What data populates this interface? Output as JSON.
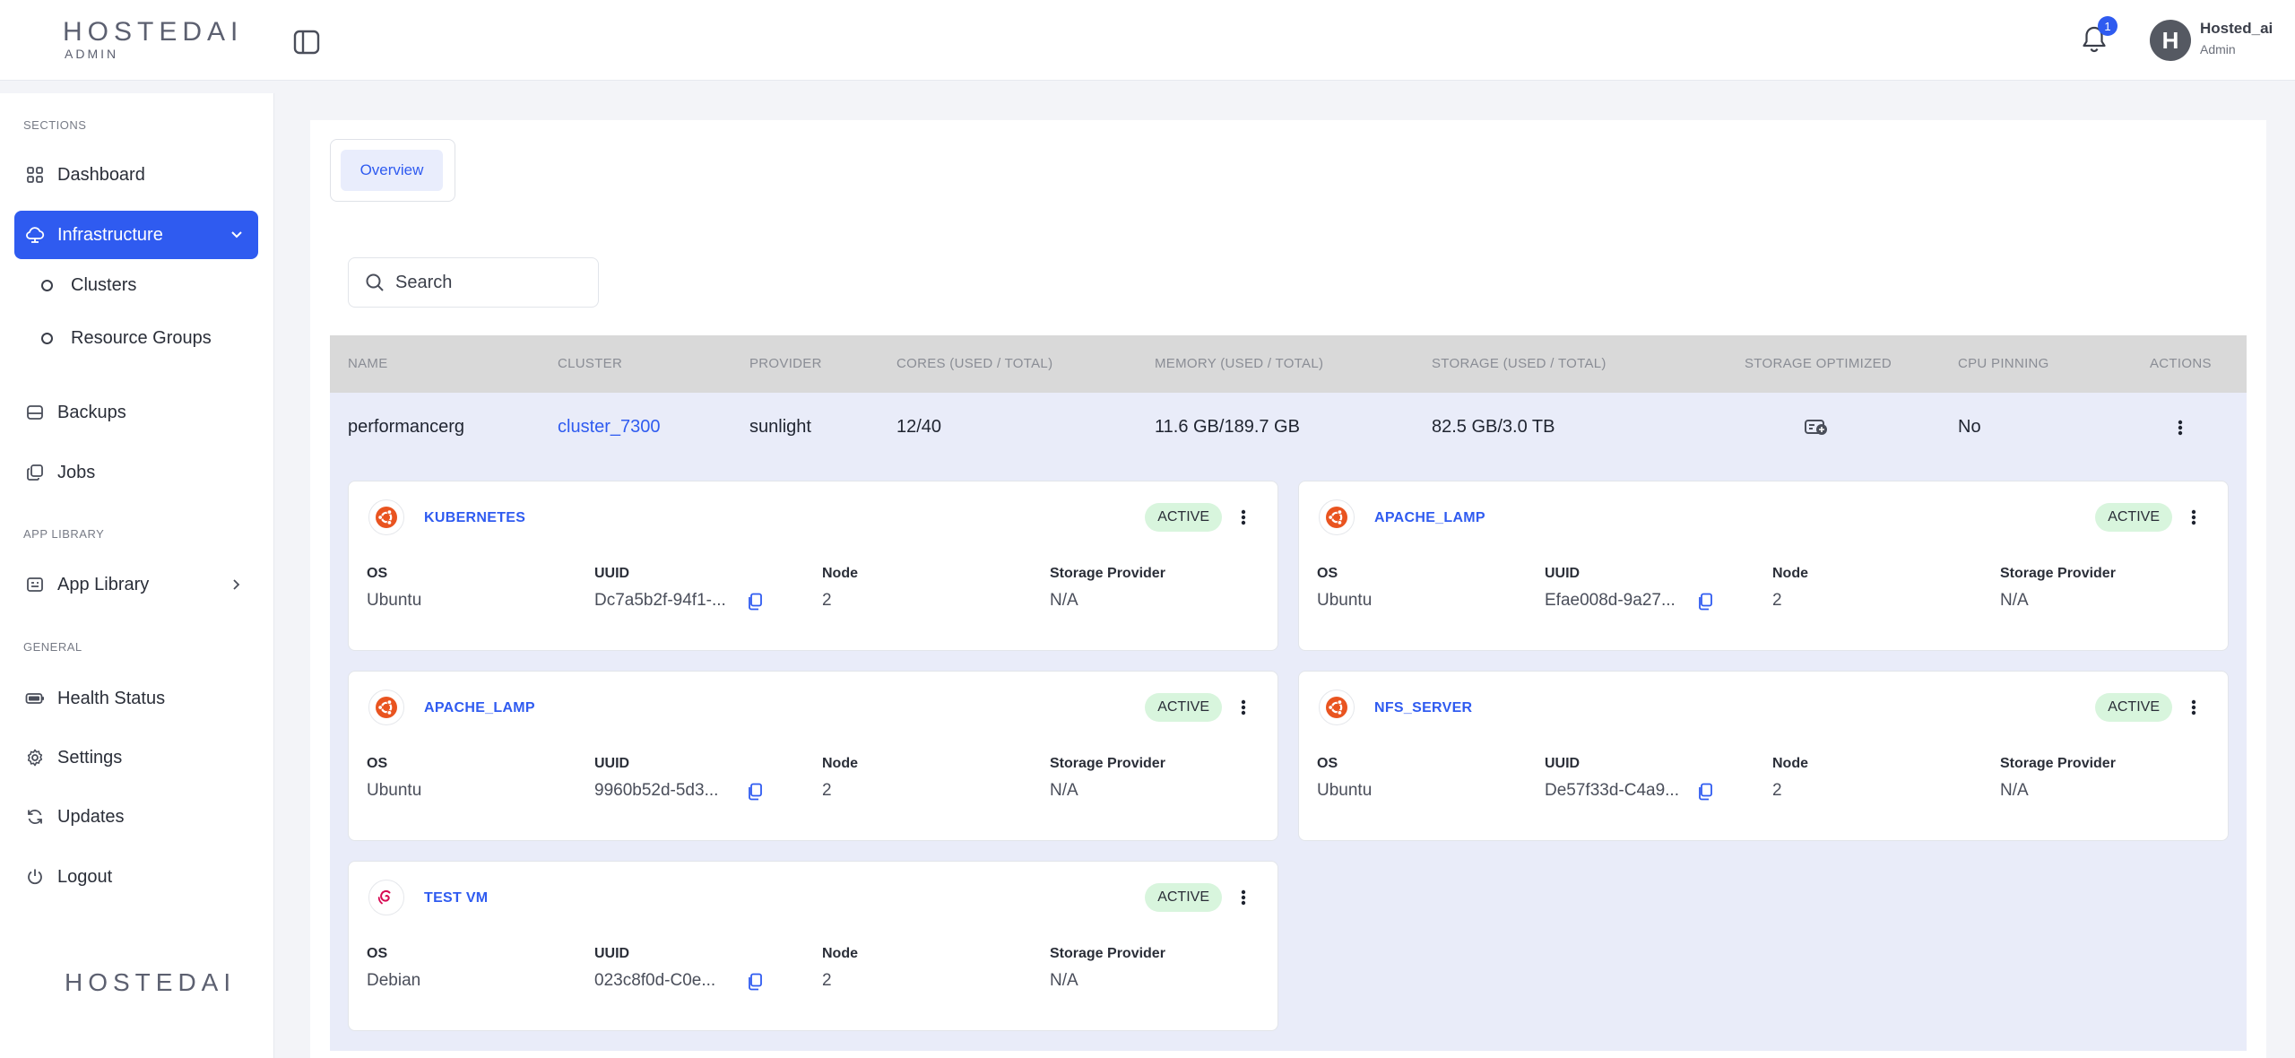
{
  "header": {
    "logo_brand": "HOSTEDAI",
    "logo_sub": "ADMIN",
    "notification_count": "1",
    "avatar_initial": "H",
    "user_name": "Hosted_ai",
    "user_role": "Admin"
  },
  "sidebar": {
    "section_sections": "SECTIONS",
    "section_app_library": "APP LIBRARY",
    "section_general": "GENERAL",
    "items": {
      "dashboard": "Dashboard",
      "infrastructure": "Infrastructure",
      "clusters": "Clusters",
      "resource_groups": "Resource Groups",
      "backups": "Backups",
      "jobs": "Jobs",
      "app_library": "App Library",
      "health_status": "Health Status",
      "settings": "Settings",
      "updates": "Updates",
      "logout": "Logout"
    },
    "footer_logo": "HOSTEDAI"
  },
  "main": {
    "tab_overview": "Overview",
    "search_placeholder": "Search",
    "table": {
      "columns": {
        "name": "NAME",
        "cluster": "CLUSTER",
        "provider": "PROVIDER",
        "cores": "CORES (USED / TOTAL)",
        "memory": "MEMORY (USED / TOTAL)",
        "storage": "STORAGE (USED / TOTAL)",
        "storage_optimized": "STORAGE OPTIMIZED",
        "cpu_pinning": "CPU PINNING",
        "actions": "ACTIONS"
      },
      "row": {
        "name": "performancerg",
        "cluster": "cluster_7300",
        "provider": "sunlight",
        "cores": "12/40",
        "memory": "11.6 GB/189.7 GB",
        "storage": "82.5 GB/3.0 TB",
        "cpu_pinning": "No"
      }
    },
    "field_labels": {
      "os": "OS",
      "uuid": "UUID",
      "node": "Node",
      "storage_provider": "Storage Provider"
    },
    "vms": [
      {
        "name": "KUBERNETES",
        "status": "ACTIVE",
        "os": "Ubuntu",
        "uuid": "Dc7a5b2f-94f1-...",
        "node": "2",
        "storage_provider": "N/A",
        "os_icon": "ubuntu-icon"
      },
      {
        "name": "APACHE_LAMP",
        "status": "ACTIVE",
        "os": "Ubuntu",
        "uuid": "Efae008d-9a27...",
        "node": "2",
        "storage_provider": "N/A",
        "os_icon": "ubuntu-icon"
      },
      {
        "name": "APACHE_LAMP",
        "status": "ACTIVE",
        "os": "Ubuntu",
        "uuid": "9960b52d-5d3...",
        "node": "2",
        "storage_provider": "N/A",
        "os_icon": "ubuntu-icon"
      },
      {
        "name": "NFS_SERVER",
        "status": "ACTIVE",
        "os": "Ubuntu",
        "uuid": "De57f33d-C4a9...",
        "node": "2",
        "storage_provider": "N/A",
        "os_icon": "ubuntu-icon"
      },
      {
        "name": "TEST VM",
        "status": "ACTIVE",
        "os": "Debian",
        "uuid": "023c8f0d-C0e...",
        "node": "2",
        "storage_provider": "N/A",
        "os_icon": "debian-icon"
      }
    ]
  },
  "colors": {
    "accent": "#2f5bf0",
    "active_badge": "#d8f5dd",
    "ubuntu": "#e95420",
    "debian": "#d70a53",
    "group_bg": "#e9ecf9"
  }
}
